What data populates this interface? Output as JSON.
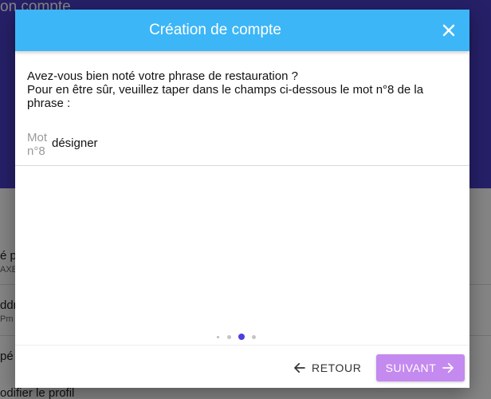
{
  "background": {
    "title": "on compte",
    "rows": [
      {
        "main": "é p",
        "sub": "AXE"
      },
      {
        "main": "ddr",
        "sub": "Pm"
      },
      {
        "main": "pé",
        "sub": ""
      },
      {
        "main": "odifier le profil",
        "sub": ""
      }
    ]
  },
  "dialog": {
    "title": "Création de compte",
    "question_line1": "Avez-vous bien noté votre phrase de restauration ?",
    "question_line2": "Pour en être sûr, veuillez taper dans le champs ci-dessous le mot n°8 de la phrase :",
    "field": {
      "label": "Mot n°8",
      "value": "désigner",
      "placeholder": ""
    },
    "stepper": {
      "total": 4,
      "active": 3
    },
    "back_label": "RETOUR",
    "next_label": "SUIVANT"
  },
  "colors": {
    "header": "#3cb6f7",
    "next_button": "#c48af0",
    "active_dot": "#4b3fe0",
    "bg_header": "#4a3fc7"
  }
}
